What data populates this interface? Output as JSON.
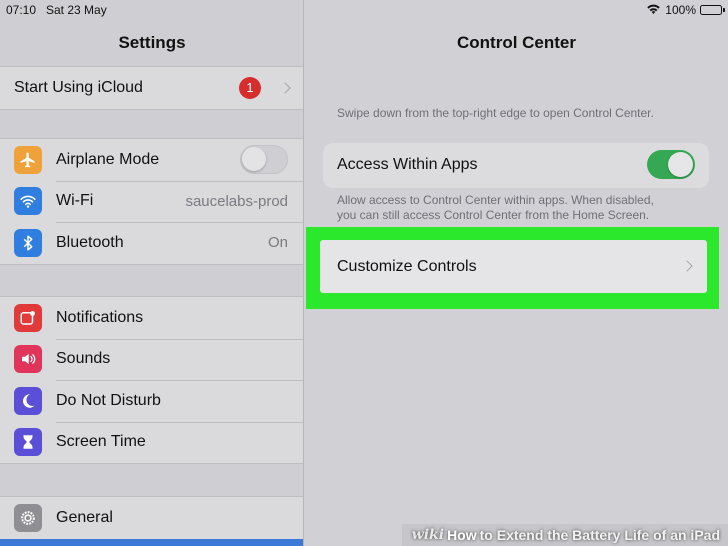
{
  "status_bar": {
    "time": "07:10",
    "date": "Sat 23 May",
    "battery": "100%",
    "icons": [
      "wifi-icon",
      "battery-icon"
    ]
  },
  "sidebar": {
    "title": "Settings",
    "icloud": {
      "label": "Start Using iCloud",
      "badge": "1"
    },
    "group1": [
      {
        "label": "Airplane Mode",
        "icon": "airplane-icon",
        "color": "#f0a23a",
        "toggle": "off"
      },
      {
        "label": "Wi-Fi",
        "icon": "wifi-icon",
        "color": "#2f7ee0",
        "value": "saucelabs-prod"
      },
      {
        "label": "Bluetooth",
        "icon": "bluetooth-icon",
        "color": "#2f7ee0",
        "value": "On"
      }
    ],
    "group2": [
      {
        "label": "Notifications",
        "icon": "notifications-icon",
        "color": "#e03a3a"
      },
      {
        "label": "Sounds",
        "icon": "sounds-icon",
        "color": "#e0345a"
      },
      {
        "label": "Do Not Disturb",
        "icon": "moon-icon",
        "color": "#5a4fd6"
      },
      {
        "label": "Screen Time",
        "icon": "hourglass-icon",
        "color": "#5a4fd6"
      }
    ],
    "group3": [
      {
        "label": "General",
        "icon": "gear-icon",
        "color": "#8e8e93"
      }
    ]
  },
  "detail": {
    "title": "Control Center",
    "hint": "Swipe down from the top-right edge to open Control Center.",
    "access_label": "Access Within Apps",
    "access_toggle": "on",
    "footnote_line1": "Allow access to Control Center within apps. When disabled,",
    "footnote_line2": "you can still access Control Center from the Home Screen.",
    "customize_label": "Customize Controls",
    "highlight_color": "#2ce82c"
  },
  "watermark": {
    "wiki": "wiki",
    "how": "How",
    "rest": "to Extend the Battery Life of an iPad"
  }
}
